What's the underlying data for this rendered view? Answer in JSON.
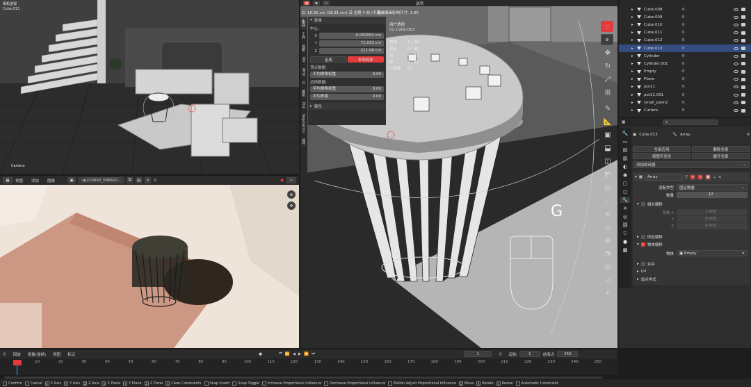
{
  "topleft": {
    "title": "相机透视",
    "object": "Cube.013",
    "camera_label": "Camera"
  },
  "render_header": {
    "menus": [
      "视图",
      "添加",
      "图像"
    ],
    "image_name": "sp210602_090610..."
  },
  "viewport": {
    "status_line": "D: 16.91 cm (16.91 cm) 沿 全局 Y 向 (平滑)",
    "prop_editing": "衰减编辑影响尺寸: 1.00",
    "header_menus": [
      "选项"
    ],
    "user_persp": "用户透视",
    "user_persp_obj": "(1) Cube.013",
    "stats": [
      {
        "label": "物体",
        "value": "1 / 24"
      },
      {
        "label": "顶点",
        "value": "4 / 48"
      },
      {
        "label": "边",
        "value": "4 / 82"
      },
      {
        "label": "面",
        "value": "1 / 46"
      },
      {
        "label": "三角面",
        "value": "92"
      }
    ],
    "gizmo_letter": "G"
  },
  "n_panel": {
    "tabs": [
      "条目",
      "工具",
      "视图",
      "MX",
      "MHX",
      "Q",
      "编辑",
      "PLR",
      "Vegetation",
      "插件"
    ],
    "section": "变换",
    "median": "中心:",
    "x_label": "X",
    "x_value": "-0.000004 cm",
    "y_label": "Y",
    "y_value": "71.033 cm",
    "z_label": "Z",
    "z_value": "211.08 cm",
    "global_btn": "全局",
    "local_btn": "本地局部",
    "vdata": "顶点数据:",
    "vcrease": "平均倒角权重",
    "vcrease_val": "0.00",
    "edata": "边线数据:",
    "ecrease": "平均倒角权重",
    "ecrease_val": "0.00",
    "eweight": "平均折痕",
    "eweight_val": "0.00",
    "props": "属性"
  },
  "outliner": {
    "items": [
      {
        "name": "Cube.008"
      },
      {
        "name": "Cube.009"
      },
      {
        "name": "Cube.010"
      },
      {
        "name": "Cube.011"
      },
      {
        "name": "Cube.012"
      },
      {
        "name": "Cube.013",
        "selected": true
      },
      {
        "name": "Cylinder"
      },
      {
        "name": "Cylinder.001"
      },
      {
        "name": "Empty"
      },
      {
        "name": "Plane"
      },
      {
        "name": "pot11"
      },
      {
        "name": "pot11.001"
      },
      {
        "name": "small_palm2"
      },
      {
        "name": "Cutters"
      }
    ]
  },
  "properties": {
    "object_name": "Cube.013",
    "modifier_name_field": "Array",
    "apply_all": "全部应用",
    "delete_all": "删除全部",
    "viewport_vis": "视图可见性",
    "expand": "展开全部",
    "add_modifier": "添加修改器",
    "mod_name": "Array",
    "fit_type_label": "适配类型",
    "fit_type_value": "固定数量",
    "count_label": "数量",
    "count_value": "12",
    "relative_offset": "相对偏移",
    "factor_x_label": "系数 X",
    "factor_x": "1.000",
    "factor_y_label": "Y",
    "factor_y": "0.000",
    "factor_z_label": "Z",
    "factor_z": "0.000",
    "constant_offset": "恒定偏移",
    "object_offset": "物体偏移",
    "object_label": "物体",
    "object_value": "Empty",
    "merge": "合并",
    "uv": "UV",
    "caps": "加点样式"
  },
  "timeline": {
    "menus": [
      "回放",
      "抠像(插帧)",
      "视图",
      "标记"
    ],
    "current_frame": "1",
    "start_label": "起始",
    "start": "1",
    "end_label": "结束点",
    "end": "250",
    "ticks": [
      "1",
      "10",
      "20",
      "30",
      "40",
      "50",
      "60",
      "70",
      "80",
      "90",
      "100",
      "110",
      "120",
      "130",
      "140",
      "150",
      "160",
      "170",
      "180",
      "190",
      "200",
      "210",
      "220",
      "230",
      "240",
      "250"
    ]
  },
  "statusbar": {
    "items": [
      {
        "key": "",
        "label": "Confirm"
      },
      {
        "key": "",
        "label": "Cancel"
      },
      {
        "key": "X",
        "label": "X Axis"
      },
      {
        "key": "Y",
        "label": "Y Axis"
      },
      {
        "key": "Z",
        "label": "Z Axis"
      },
      {
        "key": "X",
        "label": "X Plane"
      },
      {
        "key": "Y",
        "label": "Y Plane"
      },
      {
        "key": "Z",
        "label": "Z Plane"
      },
      {
        "key": "C",
        "label": "Clear Constraints"
      },
      {
        "key": "",
        "label": "Snap Invert"
      },
      {
        "key": "",
        "label": "Snap Toggle"
      },
      {
        "key": "",
        "label": "Increase Proportional Influence"
      },
      {
        "key": "",
        "label": "Decrease Proportional Influence"
      },
      {
        "key": "",
        "label": "MsPan Adjust Proportional Influence"
      },
      {
        "key": "G",
        "label": "Move"
      },
      {
        "key": "R",
        "label": "Rotate"
      },
      {
        "key": "S",
        "label": "Resize"
      },
      {
        "key": "",
        "label": "Automatic Constraint"
      }
    ]
  },
  "colors": {
    "accent": "#e33b3b",
    "selected": "#334d80",
    "bg": "#1d1d1d"
  }
}
